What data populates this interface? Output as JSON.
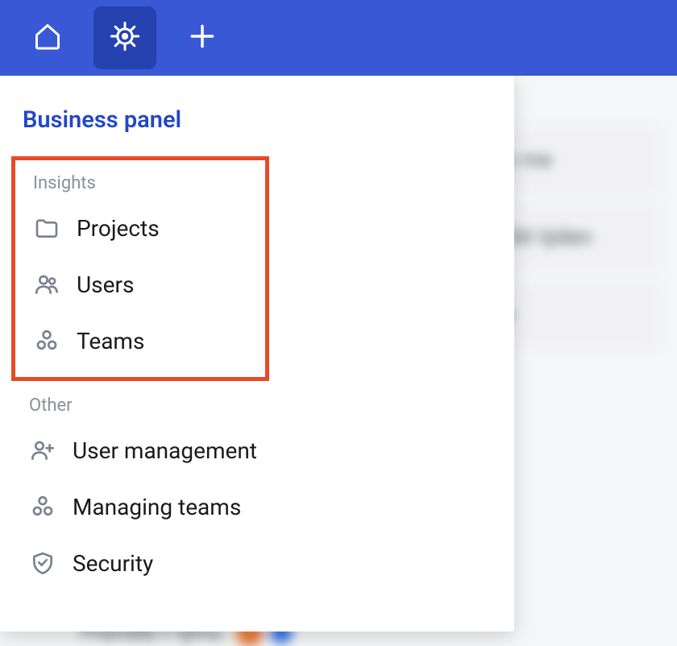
{
  "panel": {
    "title": "Business panel",
    "sections": [
      {
        "header": "Insights",
        "items": [
          {
            "label": "Projects"
          },
          {
            "label": "Users"
          },
          {
            "label": "Teams"
          }
        ]
      },
      {
        "header": "Other",
        "items": [
          {
            "label": "User management"
          },
          {
            "label": "Managing teams"
          },
          {
            "label": "Security"
          }
        ]
      }
    ]
  },
  "background": {
    "rows": [
      "gned to me",
      "mín příští týden",
      "řešitele"
    ],
    "bottom": "Pravidla v týmu"
  }
}
